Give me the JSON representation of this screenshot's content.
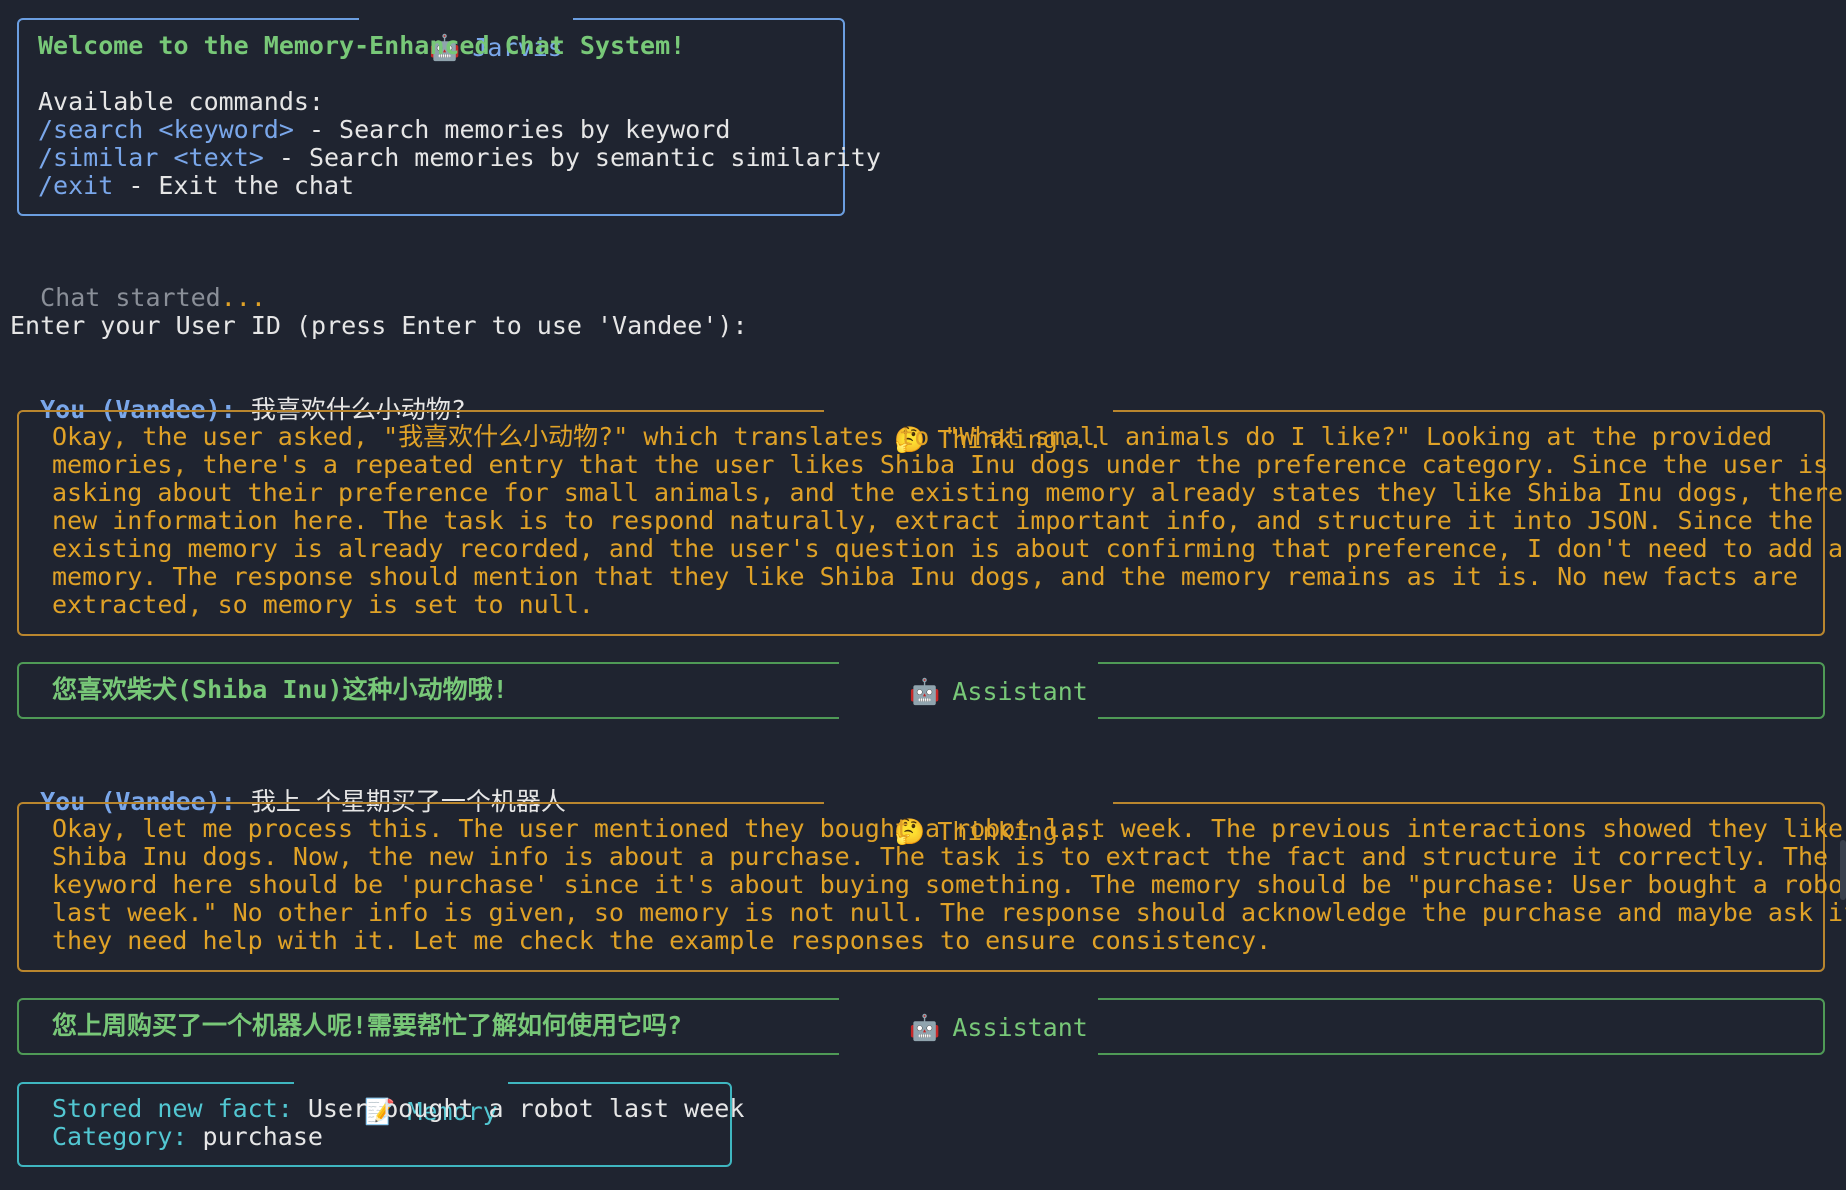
{
  "top_panel": {
    "title": "Jarvis",
    "title_icon": "robot-icon",
    "welcome": "Welcome to the Memory-Enhanced Chat System!",
    "commands_header": "Available commands:",
    "commands": [
      {
        "cmd": "/search",
        "arg": "<keyword>",
        "desc": " - Search memories by keyword"
      },
      {
        "cmd": "/similar",
        "arg": "<text>",
        "desc": " - Search memories by semantic similarity"
      },
      {
        "cmd": "/exit",
        "arg": "",
        "desc": " - Exit the chat"
      }
    ]
  },
  "status": {
    "chat_started": "Chat started",
    "dots": "..."
  },
  "prompt": {
    "user_id": "Enter your User ID (press Enter to use 'Vandee'):"
  },
  "conversation": [
    {
      "you_label": "You (Vandee):",
      "message": "我喜欢什么小动物?",
      "thinking_title": "Thinking...",
      "thinking_icon": "thinking-face-icon",
      "thinking_lines": [
        "Okay, the user asked, \"我喜欢什么小动物?\" which translates to \"What small animals do I like?\" Looking at the provided",
        "memories, there's a repeated entry that the user likes Shiba Inu dogs under the preference category. Since the user is",
        "asking about their preference for small animals, and the existing memory already states they like Shiba Inu dogs, there's no",
        "new information here. The task is to respond naturally, extract important info, and structure it into JSON. Since the",
        "existing memory is already recorded, and the user's question is about confirming that preference, I don't need to add a new",
        "memory. The response should mention that they like Shiba Inu dogs, and the memory remains as it is. No new facts are",
        "extracted, so memory is set to null."
      ],
      "assistant_title": "Assistant",
      "assistant_icon": "robot-icon",
      "assistant_reply": "您喜欢柴犬(Shiba Inu)这种小动物哦!"
    },
    {
      "you_label": "You (Vandee):",
      "message": "我上 个星期买了一个机器人",
      "thinking_title": "Thinking...",
      "thinking_icon": "thinking-face-icon",
      "thinking_lines": [
        "Okay, let me process this. The user mentioned they bought a robot last week. The previous interactions showed they like",
        "Shiba Inu dogs. Now, the new info is about a purchase. The task is to extract the fact and structure it correctly. The",
        "keyword here should be 'purchase' since it's about buying something. The memory should be \"purchase: User bought a robot",
        "last week.\" No other info is given, so memory is not null. The response should acknowledge the purchase and maybe ask if",
        "they need help with it. Let me check the example responses to ensure consistency."
      ],
      "assistant_title": "Assistant",
      "assistant_icon": "robot-icon",
      "assistant_reply": "您上周购买了一个机器人呢!需要帮忙了解如何使用它吗?"
    }
  ],
  "memory_panel": {
    "title": "Memory",
    "title_icon": "memo-icon",
    "fact_label": "Stored new fact:",
    "fact_value": " User bought a robot last week",
    "category_label": "Category:",
    "category_value": " purchase"
  },
  "colors": {
    "background": "#1f2430",
    "blue": "#7aa7ea",
    "orange": "#e0a227",
    "green": "#78c878",
    "cyan": "#52c7d2"
  }
}
